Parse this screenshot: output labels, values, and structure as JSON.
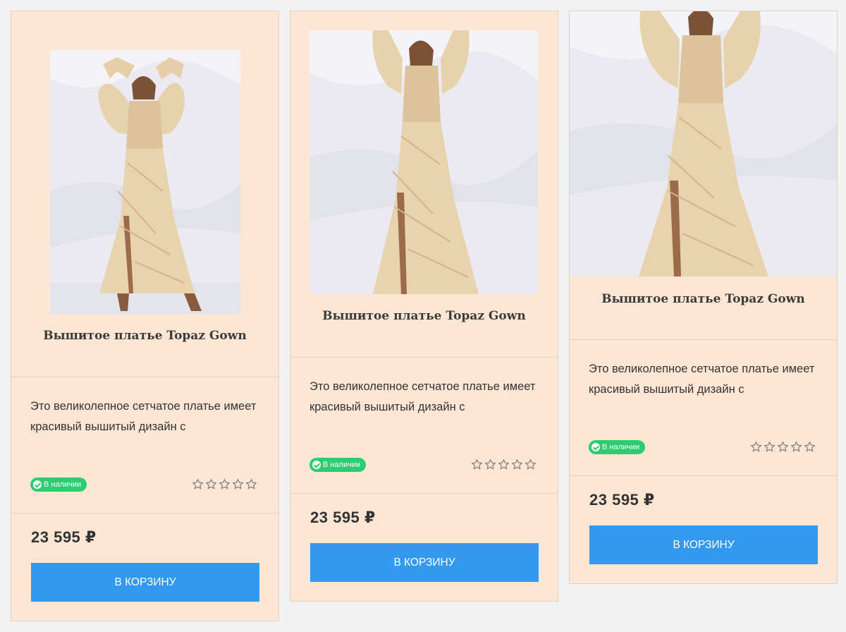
{
  "colors": {
    "card_bg": "#fee6d5",
    "button_bg": "#3399ee",
    "badge_bg": "#2ecc71"
  },
  "products": [
    {
      "title": "Вышитое платье Topaz Gown",
      "description": "Это великолепное сетчатое платье имеет красивый вышитый дизайн с",
      "stock_badge": "В наличии",
      "rating": 0,
      "rating_max": 5,
      "price": "23 595 ₽",
      "button_label": "В корзину",
      "image_icon": "dress-photo"
    },
    {
      "title": "Вышитое платье Topaz Gown",
      "description": "Это великолепное сетчатое платье имеет красивый вышитый дизайн с",
      "stock_badge": "В наличии",
      "rating": 0,
      "rating_max": 5,
      "price": "23 595 ₽",
      "button_label": "В корзину",
      "image_icon": "dress-photo"
    },
    {
      "title": "Вышитое платье Topaz Gown",
      "description": "Это великолепное сетчатое платье имеет красивый вышитый дизайн с",
      "stock_badge": "В наличии",
      "rating": 0,
      "rating_max": 5,
      "price": "23 595 ₽",
      "button_label": "В корзину",
      "image_icon": "dress-photo"
    }
  ]
}
